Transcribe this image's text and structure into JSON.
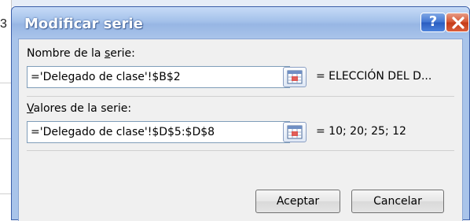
{
  "background": {
    "cell_glyph": "3"
  },
  "dialog": {
    "title": "Modificar serie",
    "help_label": "?",
    "name_section": {
      "label_pre": "Nombre de la ",
      "label_underlined": "s",
      "label_post": "erie:",
      "value": "='Delegado de clase'!$B$2",
      "preview": "= ELECCIÓN DEL D..."
    },
    "values_section": {
      "label_underlined": "V",
      "label_post": "alores de la serie:",
      "value": "='Delegado de clase'!$D$5:$D$8",
      "preview": "= 10; 20; 25; 12"
    },
    "ok_label": "Aceptar",
    "cancel_label": "Cancelar"
  },
  "colors": {
    "titlebar": "#a9c4ea",
    "close_button": "#c43a17",
    "help_button": "#2a5cc0"
  },
  "icons": {
    "help": "question-mark",
    "close": "x-icon",
    "collapse": "range-selector-icon"
  }
}
